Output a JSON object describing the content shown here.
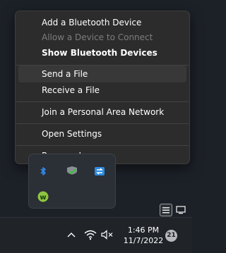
{
  "menu": {
    "items": [
      {
        "label": "Add a Bluetooth Device"
      },
      {
        "label": "Allow a Device to Connect"
      },
      {
        "label": "Show Bluetooth Devices"
      },
      {
        "label": "Send a File"
      },
      {
        "label": "Receive a File"
      },
      {
        "label": "Join a Personal Area Network"
      },
      {
        "label": "Open Settings"
      },
      {
        "label": "Remove Icon"
      }
    ]
  },
  "tray": {
    "icons": [
      "bluetooth-icon",
      "security-shield-icon",
      "network-sync-icon",
      "webroot-icon"
    ]
  },
  "taskbar": {
    "time": "1:46 PM",
    "date": "11/7/2022",
    "notification_count": "21",
    "icons": [
      "chevron-up-icon",
      "wifi-icon",
      "speaker-muted-icon"
    ]
  },
  "colors": {
    "menu_bg": "#2c2c2c",
    "hover_bg": "#383838",
    "disabled_text": "#7d7d7d",
    "accent_blue": "#1e90ff"
  }
}
